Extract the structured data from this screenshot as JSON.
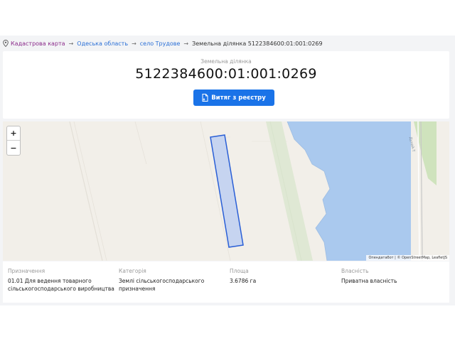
{
  "breadcrumb": {
    "items": [
      "Кадастрова карта",
      "Одеська область",
      "село Трудове"
    ],
    "separator": "→",
    "current": "Земельна ділянка 5122384600:01:001:0269"
  },
  "card": {
    "label": "Земельна ділянка",
    "cadastral_number": "5122384600:01:001:0269",
    "extract_button": "Витяг з реєстру"
  },
  "map": {
    "zoom_in": "+",
    "zoom_out": "−",
    "attribution": "Опендатабот | © OpenStreetMap, LeafletJS",
    "road_label": "Дунай-Т",
    "colors": {
      "parcel_fill": "#c6d4f0",
      "parcel_stroke": "#2a5fd6",
      "water": "#aac9ee",
      "land": "#f2efe9"
    }
  },
  "info": {
    "purpose_label": "Призначення",
    "purpose_value_line1": "01.01 Для ведення товарного",
    "purpose_value_line2": "сільськогосподарського виробництва",
    "category_label": "Категорія",
    "category_value_line1": "Землі сільськогосподарського",
    "category_value_line2": "призначення",
    "area_label": "Площа",
    "area_value": "3.6786 га",
    "ownership_label": "Власність",
    "ownership_value": "Приватна власність"
  },
  "colors": {
    "accent": "#1a73e8",
    "link": "#2a6fd6",
    "breadcrumb_first": "#8a2a8a"
  }
}
